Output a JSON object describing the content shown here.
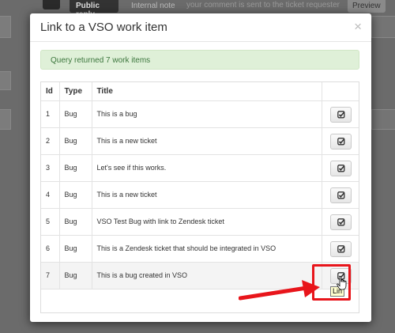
{
  "background": {
    "tab_public_reply": "Public reply",
    "tab_internal_note": "Internal note",
    "hint": "your comment is sent to the ticket requester",
    "preview": "Preview"
  },
  "modal": {
    "title": "Link to a VSO work item",
    "close_symbol": "×",
    "alert_text": "Query returned 7 work items",
    "columns": [
      "Id",
      "Type",
      "Title",
      ""
    ],
    "rows": [
      {
        "id": "1",
        "type": "Bug",
        "title": "This is a bug"
      },
      {
        "id": "2",
        "type": "Bug",
        "title": "This is a new ticket"
      },
      {
        "id": "3",
        "type": "Bug",
        "title": "Let's see if this works."
      },
      {
        "id": "4",
        "type": "Bug",
        "title": "This is a new ticket"
      },
      {
        "id": "5",
        "type": "Bug",
        "title": "VSO Test Bug with link to Zendesk ticket"
      },
      {
        "id": "6",
        "type": "Bug",
        "title": "This is a Zendesk ticket that should be integrated in VSO"
      },
      {
        "id": "7",
        "type": "Bug",
        "title": "This is a bug created in VSO"
      }
    ],
    "tooltip": "Lin"
  },
  "colors": {
    "alert_bg": "#dff0d8",
    "alert_text": "#3c763d",
    "annotation_red": "#e8151b"
  }
}
